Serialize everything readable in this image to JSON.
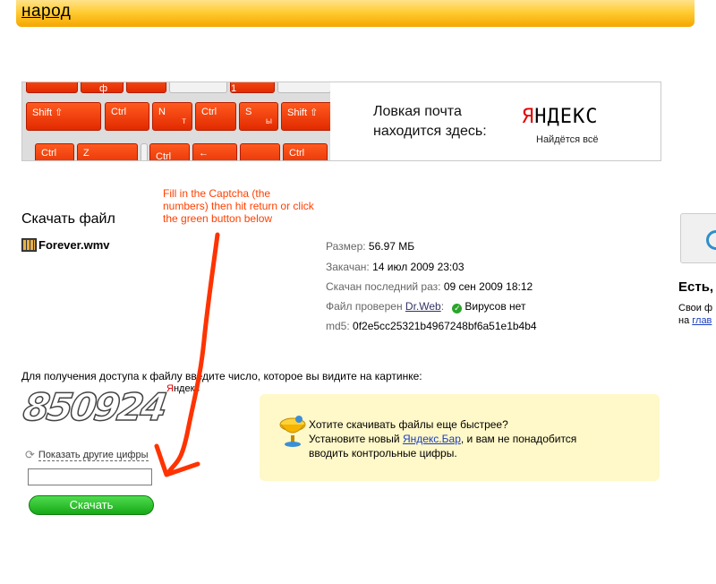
{
  "header": {
    "brand": "народ"
  },
  "banner": {
    "keys": {
      "k1": "ф",
      "k2": "1",
      "shift_left": "Shift ⇧",
      "ctrl1": "Ctrl",
      "n": "N",
      "n_sub": "т",
      "ctrl2": "Ctrl",
      "s": "S",
      "s_sub": "ы",
      "shift_right": "Shift ⇧",
      "ctrl3": "Ctrl",
      "z": "Z",
      "ctrl4": "Ctrl",
      "arrow": "←",
      "ctrl5": "Ctrl"
    },
    "line1": "Ловкая почта",
    "line2": "находится здесь:",
    "logo_first": "Я",
    "logo_rest": "НДЕКС",
    "tagline": "Найдётся всё"
  },
  "annotation": "Fill in the Captcha (the numbers) then hit return or click the green button below",
  "page_title": "Скачать файл",
  "file_name": "Forever.wmv",
  "info": {
    "size_label": "Размер:",
    "size_value": "56.97 МБ",
    "uploaded_label": "Закачан:",
    "uploaded_value": "14 июл 2009 23:03",
    "last_label": "Скачан последний раз:",
    "last_value": "09 сен 2009 18:12",
    "checked_label": "Файл проверен",
    "checked_link": "Dr.Web",
    "checked_colon": ":",
    "virus_status": "Вирусов нет",
    "md5_label": "md5:",
    "md5_value": "0f2e5cc25321b4967248bf6a51e1b4b4"
  },
  "captcha": {
    "prompt": "Для получения доступа к файлу введите число, которое вы видите на картинке:",
    "digits": "850924",
    "small_first": "Я",
    "small_rest": "ндекс",
    "refresh_label": "Показать другие цифры",
    "input_value": "",
    "button_label": "Скачать"
  },
  "promo": {
    "line1": "Хотите скачивать файлы еще быстрее?",
    "line2_pre": "Установите новый ",
    "line2_link": "Яндекс.Бар",
    "line2_post": ", и вам не понадобится",
    "line3": "вводить контрольные цифры."
  },
  "side": {
    "title": "Есть,",
    "line1": "Свои ф",
    "line2_pre": "на ",
    "line2_link": "глав"
  },
  "colors": {
    "brand_orange": "#ffcc33",
    "annotation_red": "#ff4000",
    "button_green": "#16a816",
    "promo_bg": "#fff8c8"
  }
}
